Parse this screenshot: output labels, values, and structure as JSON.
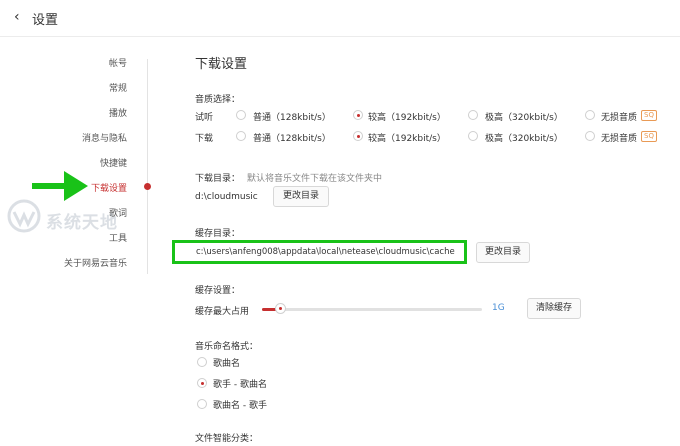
{
  "header": {
    "back_icon": "‹",
    "title": "设置"
  },
  "sidebar": {
    "items": [
      {
        "label": "帐号"
      },
      {
        "label": "常规"
      },
      {
        "label": "播放"
      },
      {
        "label": "消息与隐私"
      },
      {
        "label": "快捷键"
      },
      {
        "label": "下载设置"
      },
      {
        "label": "歌词"
      },
      {
        "label": "工具"
      },
      {
        "label": "关于网易云音乐"
      }
    ],
    "active_index": 5,
    "active_color": "#c62f2f",
    "annotation_color": "#19c218"
  },
  "watermark": {
    "text": "系统天地"
  },
  "download": {
    "section_title": "下载设置",
    "quality": {
      "label": "音质选择：",
      "rows": [
        {
          "label": "试听",
          "selected": 1
        },
        {
          "label": "下载",
          "selected": 1
        }
      ],
      "options": [
        "普通（128kbit/s）",
        "较高（192kbit/s）",
        "极高（320kbit/s）",
        "无损音质"
      ],
      "badge": "SQ"
    },
    "dir": {
      "label": "下载目录：",
      "hint": "默认将音乐文件下载在该文件夹中",
      "path": "d:\\cloudmusic",
      "change_button": "更改目录"
    },
    "cache_dir": {
      "label": "缓存目录：",
      "path": "c:\\users\\anfeng008\\appdata\\local\\netease\\cloudmusic\\cache",
      "change_button": "更改目录"
    },
    "cache_settings": {
      "label": "缓存设置：",
      "max_label": "缓存最大占用",
      "value_label": "1G",
      "level_fraction": 0.08,
      "clear_button": "清除缓存"
    },
    "naming": {
      "label": "音乐命名格式：",
      "options": [
        "歌曲名",
        "歌手 - 歌曲名",
        "歌曲名 - 歌手"
      ],
      "selected": 1
    },
    "smart_sort": {
      "label": "文件智能分类："
    }
  }
}
